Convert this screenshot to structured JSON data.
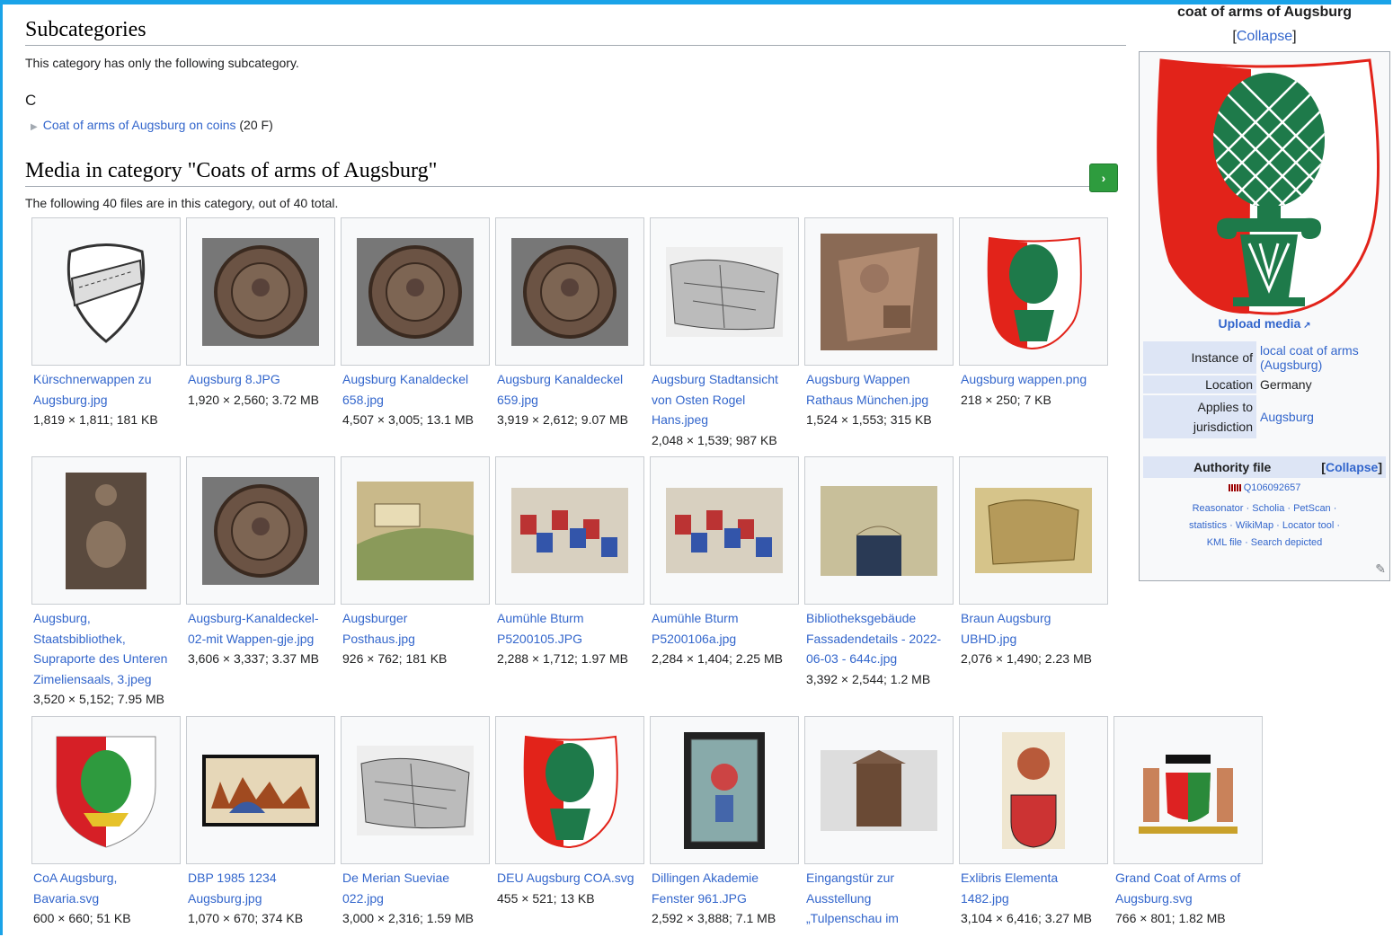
{
  "subcategories": {
    "heading": "Subcategories",
    "intro": "This category has only the following subcategory.",
    "letter": "C",
    "item_label": "Coat of arms of Augsburg on coins",
    "item_count": "(20 F)"
  },
  "media": {
    "heading": "Media in category \"Coats of arms of Augsburg\"",
    "intro": "The following 40 files are in this category, out of 40 total.",
    "next_label": "›"
  },
  "gallery": [
    {
      "name": [
        "Kürschnerwappen zu",
        "Augsburg.jpg"
      ],
      "meta": "1,819 × 1,811; 181 KB",
      "icon": "shield-sketch"
    },
    {
      "name": [
        "Augsburg 8.JPG"
      ],
      "meta": "1,920 × 2,560; 3.72 MB",
      "icon": "manhole-cover"
    },
    {
      "name": [
        "Augsburg Kanaldeckel",
        "658.jpg"
      ],
      "meta": "4,507 × 3,005; 13.1 MB",
      "icon": "manhole-cover"
    },
    {
      "name": [
        "Augsburg Kanaldeckel",
        "659.jpg"
      ],
      "meta": "3,919 × 2,612; 9.07 MB",
      "icon": "manhole-cover"
    },
    {
      "name": [
        "Augsburg Stadtansicht",
        "von Osten Rogel",
        "Hans.jpeg"
      ],
      "meta": "2,048 × 1,539; 987 KB",
      "icon": "city-map"
    },
    {
      "name": [
        "Augsburg Wappen",
        "Rathaus München.jpg"
      ],
      "meta": "1,524 × 1,553; 315 KB",
      "icon": "stone-relief"
    },
    {
      "name": [
        "Augsburg wappen.png"
      ],
      "meta": "218 × 250; 7 KB",
      "icon": "coat-of-arms"
    },
    {
      "name": [
        "Augsburg,",
        "Staatsbibliothek,",
        "Supraporte des Unteren",
        "Zimeliensaals, 3.jpeg"
      ],
      "meta": "3,520 × 5,152; 7.95 MB",
      "icon": "bronze-relief"
    },
    {
      "name": [
        "Augsburg-Kanaldeckel-",
        "02-mit Wappen-gje.jpg"
      ],
      "meta": "3,606 × 3,337; 3.37 MB",
      "icon": "manhole-cover"
    },
    {
      "name": [
        "Augsburger",
        "Posthaus.jpg"
      ],
      "meta": "926 × 762; 181 KB",
      "icon": "landscape-painting"
    },
    {
      "name": [
        "Aumühle Bturm",
        "P5200105.JPG"
      ],
      "meta": "2,288 × 1,712; 1.97 MB",
      "icon": "painted-shields"
    },
    {
      "name": [
        "Aumühle Bturm",
        "P5200106a.jpg"
      ],
      "meta": "2,284 × 1,404; 2.25 MB",
      "icon": "painted-shields"
    },
    {
      "name": [
        "Bibliotheksgebäude",
        "Fassadendetails - 2022-",
        "06-03 - 644c.jpg"
      ],
      "meta": "3,392 × 2,544; 1.2 MB",
      "icon": "building-facade"
    },
    {
      "name": [
        "Braun Augsburg",
        "UBHD.jpg"
      ],
      "meta": "2,076 × 1,490; 2.23 MB",
      "icon": "old-map"
    },
    {
      "name": [
        "CoA Augsburg,",
        "Bavaria.svg"
      ],
      "meta": "600 × 660; 51 KB",
      "icon": "shield-pinecone"
    },
    {
      "name": [
        "DBP 1985 1234",
        "Augsburg.jpg"
      ],
      "meta": "1,070 × 670; 374 KB",
      "icon": "postage-stamp"
    },
    {
      "name": [
        "De Merian Sueviae",
        "022.jpg"
      ],
      "meta": "3,000 × 2,316; 1.59 MB",
      "icon": "city-map"
    },
    {
      "name": [
        "DEU Augsburg COA.svg"
      ],
      "meta": "455 × 521; 13 KB",
      "icon": "coat-of-arms"
    },
    {
      "name": [
        "Dillingen Akademie",
        "Fenster 961.JPG"
      ],
      "meta": "2,592 × 3,888; 7.1 MB",
      "icon": "stained-glass"
    },
    {
      "name": [
        "Eingangstür zur",
        "Ausstellung",
        "„Tulpenschau im"
      ],
      "meta": "",
      "icon": "doorway"
    },
    {
      "name": [
        "Exlibris Elementa",
        "1482.jpg"
      ],
      "meta": "3,104 × 6,416; 3.27 MB",
      "icon": "heraldic-drawing"
    },
    {
      "name": [
        "Grand Coat of Arms of",
        "Augsburg.svg"
      ],
      "meta": "766 × 801; 1.82 MB",
      "icon": "grand-coat-of-arms"
    }
  ],
  "infobox": {
    "title": "coat of arms of Augsburg",
    "collapse": "[Collapse]",
    "upload": "Upload media",
    "rows": [
      {
        "key": "Instance of",
        "value": "local coat of arms",
        "extra": "(Augsburg)"
      },
      {
        "key": "Location",
        "value": "Germany"
      },
      {
        "key": "Applies to jurisdiction",
        "value": "Augsburg"
      }
    ],
    "authority": "Authority file",
    "authority_collapse": "[Collapse]",
    "qid": "Q106092657",
    "links_line1": "Reasonator · Scholia · PetScan ·",
    "links_line2": "statistics · WikiMap · Locator tool ·",
    "links_line3": "KML file · Search depicted"
  },
  "colors": {
    "link": "#3366cc",
    "accent": "#1aa3e8",
    "green": "#1e7a4a",
    "red": "#e2231a"
  }
}
